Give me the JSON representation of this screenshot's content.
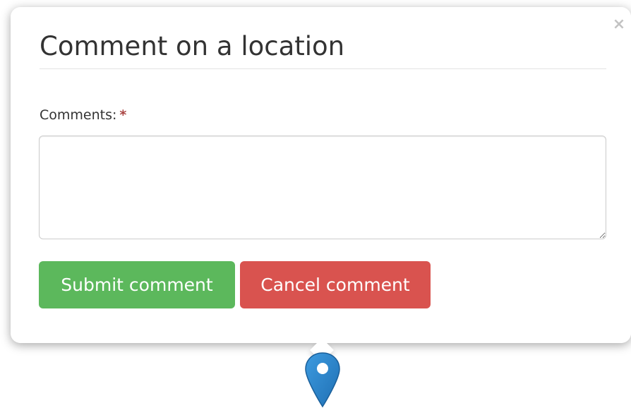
{
  "popup": {
    "title": "Comment on a location",
    "close_label": "×",
    "comments": {
      "label": "Comments:",
      "required_mark": "*",
      "value": "",
      "placeholder": ""
    },
    "buttons": {
      "submit_label": "Submit comment",
      "cancel_label": "Cancel comment"
    }
  },
  "colors": {
    "submit": "#5cb85c",
    "cancel": "#d9534f",
    "required": "#a94442",
    "marker": "#2a81cb"
  },
  "icons": {
    "close": "close-icon",
    "marker": "map-marker-icon"
  }
}
